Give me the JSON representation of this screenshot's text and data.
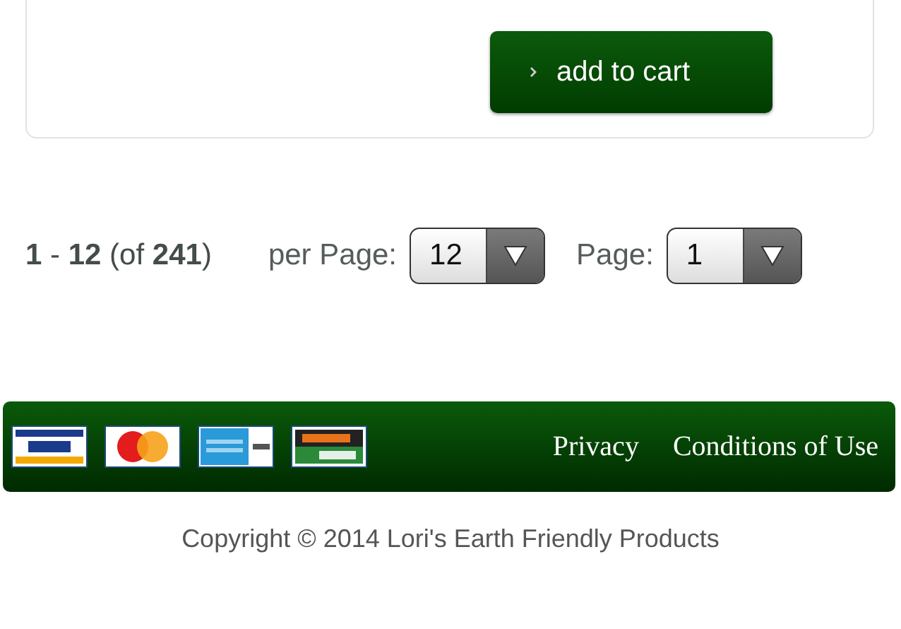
{
  "product_card": {
    "button": "add to cart"
  },
  "pagination": {
    "range": "**1** - **12** (of **241**)",
    "per_page": {
      "label": "per Page:",
      "value": "12"
    },
    "page": {
      "label": "Page:",
      "value": "1"
    }
  },
  "footer": {
    "payment_cards": [
      {
        "kind": "visa"
      },
      {
        "kind": "mastercard"
      },
      {
        "kind": "amex"
      },
      {
        "kind": "discover"
      }
    ],
    "links": [
      "Privacy",
      "Conditions of Use"
    ]
  },
  "copyright": "Copyright © 2014 Lori's Earth Friendly Products"
}
